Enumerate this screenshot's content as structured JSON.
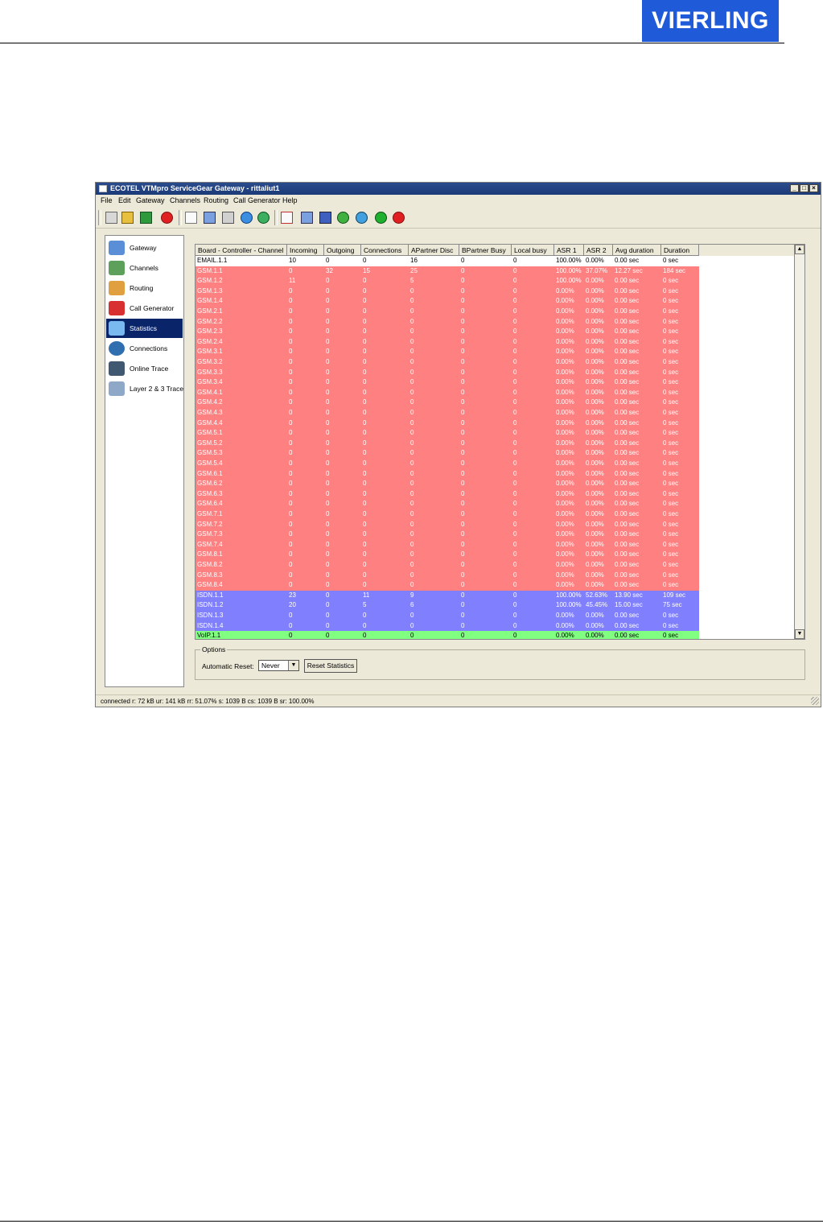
{
  "brand": {
    "logo_text": "VIERLING",
    "logo_color": "#1f5bd8"
  },
  "window": {
    "title": "ECOTEL VTMpro ServiceGear Gateway - rittaliut1",
    "controls": [
      "_",
      "□",
      "×"
    ]
  },
  "menu": [
    "File",
    "Edit",
    "Gateway",
    "Channels",
    "Routing",
    "Call Generator",
    "Help"
  ],
  "toolbar_icons": [
    "connect-icon",
    "disconnect-icon",
    "gateway-icon",
    "stop-icon",
    "new-icon",
    "open-icon",
    "save-icon",
    "upload-icon",
    "download-icon",
    "new-config-icon",
    "open-config-icon",
    "save-config-icon",
    "send-config-icon",
    "receive-config-icon",
    "refresh-icon",
    "cancel-icon"
  ],
  "nav": [
    {
      "label": "Gateway",
      "icon": "gateway-icon",
      "active": false
    },
    {
      "label": "Channels",
      "icon": "channels-icon",
      "active": false
    },
    {
      "label": "Routing",
      "icon": "routing-icon",
      "active": false
    },
    {
      "label": "Call Generator",
      "icon": "phone-icon",
      "active": false
    },
    {
      "label": "Statistics",
      "icon": "statistics-icon",
      "active": true
    },
    {
      "label": "Connections",
      "icon": "globe-icon",
      "active": false
    },
    {
      "label": "Online Trace",
      "icon": "trace-icon",
      "active": false
    },
    {
      "label": "Layer 2 & 3 Trace",
      "icon": "layer-trace-icon",
      "active": false
    }
  ],
  "table": {
    "columns": [
      "Board - Controller - Channel",
      "Incoming",
      "Outgoing",
      "Connections",
      "APartner Disc",
      "BPartner Busy",
      "Local busy",
      "ASR 1",
      "ASR 2",
      "Avg duration",
      "Duration"
    ],
    "rows": [
      {
        "cells": [
          "EMAIL.1.1",
          "10",
          "0",
          "0",
          "16",
          "0",
          "0",
          "100.00%",
          "0.00%",
          "0.00 sec",
          "0 sec"
        ],
        "color": "white"
      },
      {
        "cells": [
          "GSM.1.1",
          "0",
          "32",
          "15",
          "25",
          "0",
          "0",
          "100.00%",
          "37.07%",
          "12.27 sec",
          "184 sec"
        ],
        "color": "red"
      },
      {
        "cells": [
          "GSM.1.2",
          "11",
          "0",
          "0",
          "5",
          "0",
          "0",
          "100.00%",
          "0.00%",
          "0.00 sec",
          "0 sec"
        ],
        "color": "red"
      },
      {
        "cells": [
          "GSM.1.3",
          "0",
          "0",
          "0",
          "0",
          "0",
          "0",
          "0.00%",
          "0.00%",
          "0.00 sec",
          "0 sec"
        ],
        "color": "red"
      },
      {
        "cells": [
          "GSM.1.4",
          "0",
          "0",
          "0",
          "0",
          "0",
          "0",
          "0.00%",
          "0.00%",
          "0.00 sec",
          "0 sec"
        ],
        "color": "red"
      },
      {
        "cells": [
          "GSM.2.1",
          "0",
          "0",
          "0",
          "0",
          "0",
          "0",
          "0.00%",
          "0.00%",
          "0.00 sec",
          "0 sec"
        ],
        "color": "red"
      },
      {
        "cells": [
          "GSM.2.2",
          "0",
          "0",
          "0",
          "0",
          "0",
          "0",
          "0.00%",
          "0.00%",
          "0.00 sec",
          "0 sec"
        ],
        "color": "red"
      },
      {
        "cells": [
          "GSM.2.3",
          "0",
          "0",
          "0",
          "0",
          "0",
          "0",
          "0.00%",
          "0.00%",
          "0.00 sec",
          "0 sec"
        ],
        "color": "red"
      },
      {
        "cells": [
          "GSM.2.4",
          "0",
          "0",
          "0",
          "0",
          "0",
          "0",
          "0.00%",
          "0.00%",
          "0.00 sec",
          "0 sec"
        ],
        "color": "red"
      },
      {
        "cells": [
          "GSM.3.1",
          "0",
          "0",
          "0",
          "0",
          "0",
          "0",
          "0.00%",
          "0.00%",
          "0.00 sec",
          "0 sec"
        ],
        "color": "red"
      },
      {
        "cells": [
          "GSM.3.2",
          "0",
          "0",
          "0",
          "0",
          "0",
          "0",
          "0.00%",
          "0.00%",
          "0.00 sec",
          "0 sec"
        ],
        "color": "red"
      },
      {
        "cells": [
          "GSM.3.3",
          "0",
          "0",
          "0",
          "0",
          "0",
          "0",
          "0.00%",
          "0.00%",
          "0.00 sec",
          "0 sec"
        ],
        "color": "red"
      },
      {
        "cells": [
          "GSM.3.4",
          "0",
          "0",
          "0",
          "0",
          "0",
          "0",
          "0.00%",
          "0.00%",
          "0.00 sec",
          "0 sec"
        ],
        "color": "red"
      },
      {
        "cells": [
          "GSM.4.1",
          "0",
          "0",
          "0",
          "0",
          "0",
          "0",
          "0.00%",
          "0.00%",
          "0.00 sec",
          "0 sec"
        ],
        "color": "red"
      },
      {
        "cells": [
          "GSM.4.2",
          "0",
          "0",
          "0",
          "0",
          "0",
          "0",
          "0.00%",
          "0.00%",
          "0.00 sec",
          "0 sec"
        ],
        "color": "red"
      },
      {
        "cells": [
          "GSM.4.3",
          "0",
          "0",
          "0",
          "0",
          "0",
          "0",
          "0.00%",
          "0.00%",
          "0.00 sec",
          "0 sec"
        ],
        "color": "red"
      },
      {
        "cells": [
          "GSM.4.4",
          "0",
          "0",
          "0",
          "0",
          "0",
          "0",
          "0.00%",
          "0.00%",
          "0.00 sec",
          "0 sec"
        ],
        "color": "red"
      },
      {
        "cells": [
          "GSM.5.1",
          "0",
          "0",
          "0",
          "0",
          "0",
          "0",
          "0.00%",
          "0.00%",
          "0.00 sec",
          "0 sec"
        ],
        "color": "red"
      },
      {
        "cells": [
          "GSM.5.2",
          "0",
          "0",
          "0",
          "0",
          "0",
          "0",
          "0.00%",
          "0.00%",
          "0.00 sec",
          "0 sec"
        ],
        "color": "red"
      },
      {
        "cells": [
          "GSM.5.3",
          "0",
          "0",
          "0",
          "0",
          "0",
          "0",
          "0.00%",
          "0.00%",
          "0.00 sec",
          "0 sec"
        ],
        "color": "red"
      },
      {
        "cells": [
          "GSM.5.4",
          "0",
          "0",
          "0",
          "0",
          "0",
          "0",
          "0.00%",
          "0.00%",
          "0.00 sec",
          "0 sec"
        ],
        "color": "red"
      },
      {
        "cells": [
          "GSM.6.1",
          "0",
          "0",
          "0",
          "0",
          "0",
          "0",
          "0.00%",
          "0.00%",
          "0.00 sec",
          "0 sec"
        ],
        "color": "red"
      },
      {
        "cells": [
          "GSM.6.2",
          "0",
          "0",
          "0",
          "0",
          "0",
          "0",
          "0.00%",
          "0.00%",
          "0.00 sec",
          "0 sec"
        ],
        "color": "red"
      },
      {
        "cells": [
          "GSM.6.3",
          "0",
          "0",
          "0",
          "0",
          "0",
          "0",
          "0.00%",
          "0.00%",
          "0.00 sec",
          "0 sec"
        ],
        "color": "red"
      },
      {
        "cells": [
          "GSM.6.4",
          "0",
          "0",
          "0",
          "0",
          "0",
          "0",
          "0.00%",
          "0.00%",
          "0.00 sec",
          "0 sec"
        ],
        "color": "red"
      },
      {
        "cells": [
          "GSM.7.1",
          "0",
          "0",
          "0",
          "0",
          "0",
          "0",
          "0.00%",
          "0.00%",
          "0.00 sec",
          "0 sec"
        ],
        "color": "red"
      },
      {
        "cells": [
          "GSM.7.2",
          "0",
          "0",
          "0",
          "0",
          "0",
          "0",
          "0.00%",
          "0.00%",
          "0.00 sec",
          "0 sec"
        ],
        "color": "red"
      },
      {
        "cells": [
          "GSM.7.3",
          "0",
          "0",
          "0",
          "0",
          "0",
          "0",
          "0.00%",
          "0.00%",
          "0.00 sec",
          "0 sec"
        ],
        "color": "red"
      },
      {
        "cells": [
          "GSM.7.4",
          "0",
          "0",
          "0",
          "0",
          "0",
          "0",
          "0.00%",
          "0.00%",
          "0.00 sec",
          "0 sec"
        ],
        "color": "red"
      },
      {
        "cells": [
          "GSM.8.1",
          "0",
          "0",
          "0",
          "0",
          "0",
          "0",
          "0.00%",
          "0.00%",
          "0.00 sec",
          "0 sec"
        ],
        "color": "red"
      },
      {
        "cells": [
          "GSM.8.2",
          "0",
          "0",
          "0",
          "0",
          "0",
          "0",
          "0.00%",
          "0.00%",
          "0.00 sec",
          "0 sec"
        ],
        "color": "red"
      },
      {
        "cells": [
          "GSM.8.3",
          "0",
          "0",
          "0",
          "0",
          "0",
          "0",
          "0.00%",
          "0.00%",
          "0.00 sec",
          "0 sec"
        ],
        "color": "red"
      },
      {
        "cells": [
          "GSM.8.4",
          "0",
          "0",
          "0",
          "0",
          "0",
          "0",
          "0.00%",
          "0.00%",
          "0.00 sec",
          "0 sec"
        ],
        "color": "red"
      },
      {
        "cells": [
          "ISDN.1.1",
          "23",
          "0",
          "11",
          "9",
          "0",
          "0",
          "100.00%",
          "52.63%",
          "13.90 sec",
          "109 sec"
        ],
        "color": "blue"
      },
      {
        "cells": [
          "ISDN.1.2",
          "20",
          "0",
          "5",
          "6",
          "0",
          "0",
          "100.00%",
          "45.45%",
          "15.00 sec",
          "75 sec"
        ],
        "color": "blue"
      },
      {
        "cells": [
          "ISDN.1.3",
          "0",
          "0",
          "0",
          "0",
          "0",
          "0",
          "0.00%",
          "0.00%",
          "0.00 sec",
          "0 sec"
        ],
        "color": "blue"
      },
      {
        "cells": [
          "ISDN.1.4",
          "0",
          "0",
          "0",
          "0",
          "0",
          "0",
          "0.00%",
          "0.00%",
          "0.00 sec",
          "0 sec"
        ],
        "color": "blue"
      },
      {
        "cells": [
          "VoIP.1.1",
          "0",
          "0",
          "0",
          "0",
          "0",
          "0",
          "0.00%",
          "0.00%",
          "0.00 sec",
          "0 sec"
        ],
        "color": "green"
      }
    ]
  },
  "options": {
    "legend": "Options",
    "reset_label": "Automatic Reset:",
    "reset_value": "Never",
    "reset_button": "Reset Statistics"
  },
  "status": "connected r: 72 kB ur: 141 kB rr: 51.07% s: 1039 B cs: 1039 B sr: 100.00%",
  "colors": {
    "red": "#ff8080",
    "blue": "#8080ff",
    "green": "#80ff80",
    "titlebar": "#1c3a78"
  }
}
